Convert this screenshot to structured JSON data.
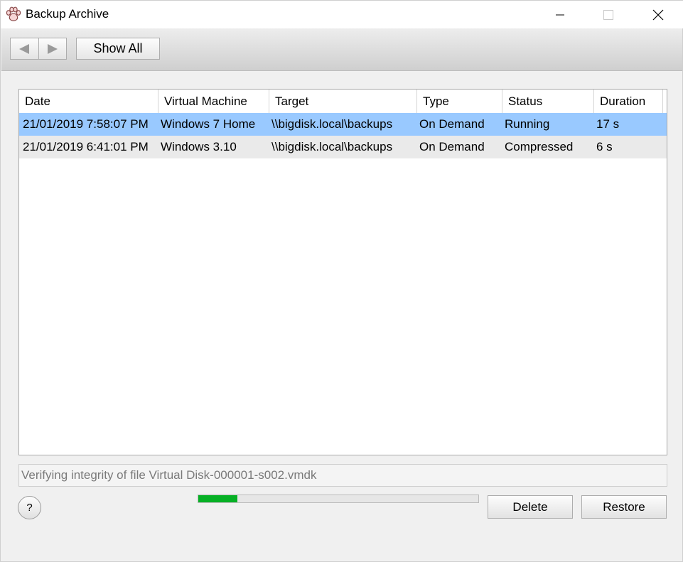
{
  "window": {
    "title": "Backup Archive",
    "icon": "paw-icon"
  },
  "toolbar": {
    "back_icon": "back-arrow-icon",
    "forward_icon": "forward-arrow-icon",
    "show_all_label": "Show All"
  },
  "table": {
    "columns": [
      "Date",
      "Virtual Machine",
      "Target",
      "Type",
      "Status",
      "Duration"
    ],
    "rows": [
      {
        "date": "21/01/2019 7:58:07 PM",
        "vm": "Windows 7 Home",
        "target": "\\\\bigdisk.local\\backups",
        "type": "On Demand",
        "status": "Running",
        "duration": "17 s",
        "selected": true
      },
      {
        "date": "21/01/2019 6:41:01 PM",
        "vm": "Windows 3.10",
        "target": "\\\\bigdisk.local\\backups",
        "type": "On Demand",
        "status": "Compressed",
        "duration": "6 s",
        "selected": false
      }
    ]
  },
  "status": {
    "message": "Verifying integrity of file Virtual Disk-000001-s002.vmdk",
    "progress_percent": 14
  },
  "buttons": {
    "help_label": "?",
    "delete_label": "Delete",
    "restore_label": "Restore"
  },
  "colors": {
    "selection": "#99c9ff",
    "progress": "#06b025"
  }
}
